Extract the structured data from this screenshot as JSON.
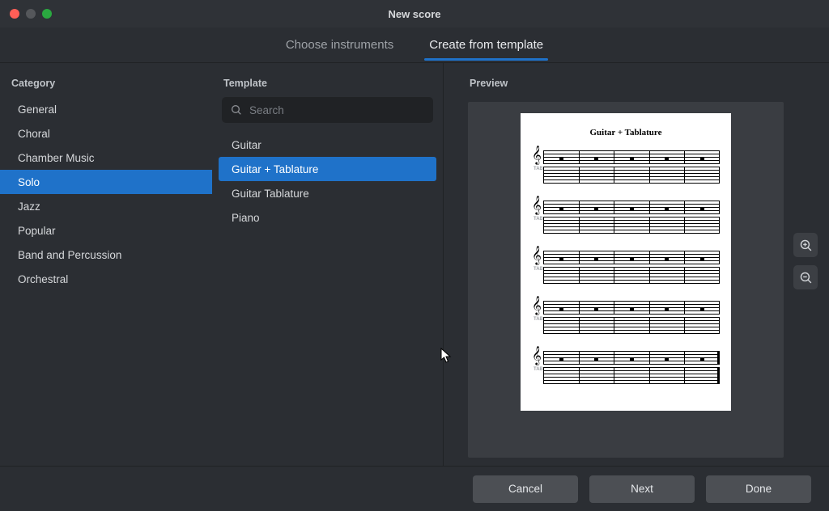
{
  "window": {
    "title": "New score"
  },
  "tabs": {
    "choose_instruments": "Choose instruments",
    "create_from_template": "Create from template",
    "active": "create_from_template"
  },
  "headings": {
    "category": "Category",
    "template": "Template",
    "preview": "Preview"
  },
  "categories": {
    "selected": "Solo",
    "items": [
      "General",
      "Choral",
      "Chamber Music",
      "Solo",
      "Jazz",
      "Popular",
      "Band and Percussion",
      "Orchestral"
    ]
  },
  "search": {
    "placeholder": "Search",
    "value": ""
  },
  "templates": {
    "selected": "Guitar + Tablature",
    "items": [
      "Guitar",
      "Guitar + Tablature",
      "Guitar Tablature",
      "Piano"
    ]
  },
  "preview": {
    "page_title": "Guitar + Tablature",
    "tab_clef": "TAB"
  },
  "buttons": {
    "cancel": "Cancel",
    "next": "Next",
    "done": "Done"
  },
  "icons": {
    "zoom_in": "zoom-in",
    "zoom_out": "zoom-out",
    "search": "search"
  },
  "colors": {
    "accent": "#1f72c9"
  }
}
